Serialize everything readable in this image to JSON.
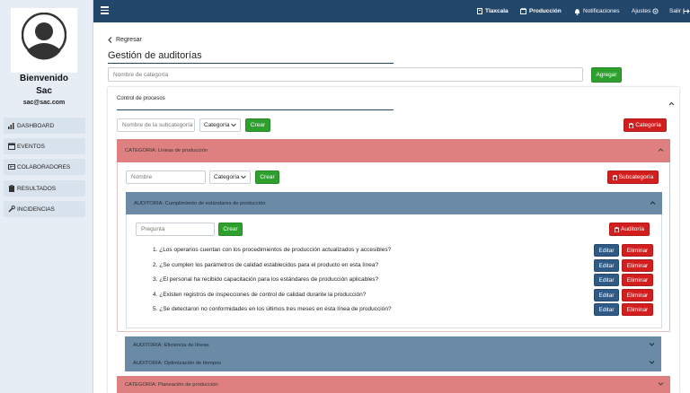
{
  "sidebar": {
    "welcome_line1": "Bienvenido",
    "welcome_line2": "Sac",
    "email": "sac@sac.com",
    "items": [
      {
        "label": "DASHBOARD",
        "icon": "bar-chart-icon"
      },
      {
        "label": "EVENTOS",
        "icon": "calendar-icon"
      },
      {
        "label": "COLABORADORES",
        "icon": "id-card-icon"
      },
      {
        "label": "RESULTADOS",
        "icon": "clipboard-icon"
      },
      {
        "label": "INCIDENCIAS",
        "icon": "wrench-icon"
      }
    ]
  },
  "topbar": {
    "tlaxcala": "Tlaxcala",
    "produccion": "Producción",
    "notificaciones": "Notificaciones",
    "ajustes": "Ajustes",
    "salir": "Salir"
  },
  "page": {
    "back_label": "Regresar",
    "title": "Gestión de auditorías",
    "category_name_placeholder": "Nombre de categoría",
    "add_button": "Agregar"
  },
  "control": {
    "title": "Control de procesos",
    "subcategory_placeholder": "Nombre de la subcategoría",
    "select_value": "Categoría",
    "create_button": "Crear",
    "delete_category_button": "Categoría"
  },
  "category_lineas": {
    "header": "CATEGORIA: Lineas de producción",
    "name_placeholder": "Nombre",
    "select_value": "Categoría",
    "create_button": "Crear",
    "delete_subcategory_button": "Subcategoría"
  },
  "audit_cumplimiento": {
    "header": "AUDITORIA: Cumplimiento de estándares de producción",
    "question_placeholder": "Pregunta",
    "create_button": "Crear",
    "delete_audit_button": "Auditoría",
    "edit_label": "Editar",
    "delete_label": "Eliminar",
    "questions": [
      "1. ¿Los operarios cuentan con los procedimientos de producción actualizados y accesibles?",
      "2. ¿Se cumplen los parámetros de calidad establecidos para el producto en esta línea?",
      "3. ¿El personal ha recibido capacitación para los estándares de producción aplicables?",
      "4. ¿Existen registros de inspecciones de control de calidad durante la producción?",
      "5. ¿Se detectaron no conformidades en los últimos tres meses en esta línea de producción?"
    ]
  },
  "audit_eficiencia": {
    "header": "AUDITORIA: Eficiencia de líneas"
  },
  "audit_optimizacion": {
    "header": "AUDITORIA: Optimización de tiempos"
  },
  "category_planeacion": {
    "header": "CATEGORIA: Planeación de producción"
  },
  "colors": {
    "topbar": "#23466b",
    "sidebar": "#e6edf5",
    "green": "#2ea02e",
    "red": "#d21e1e",
    "category_header": "#df8080",
    "audit_header": "#6a8aa5",
    "edit_button": "#2f5a86"
  }
}
